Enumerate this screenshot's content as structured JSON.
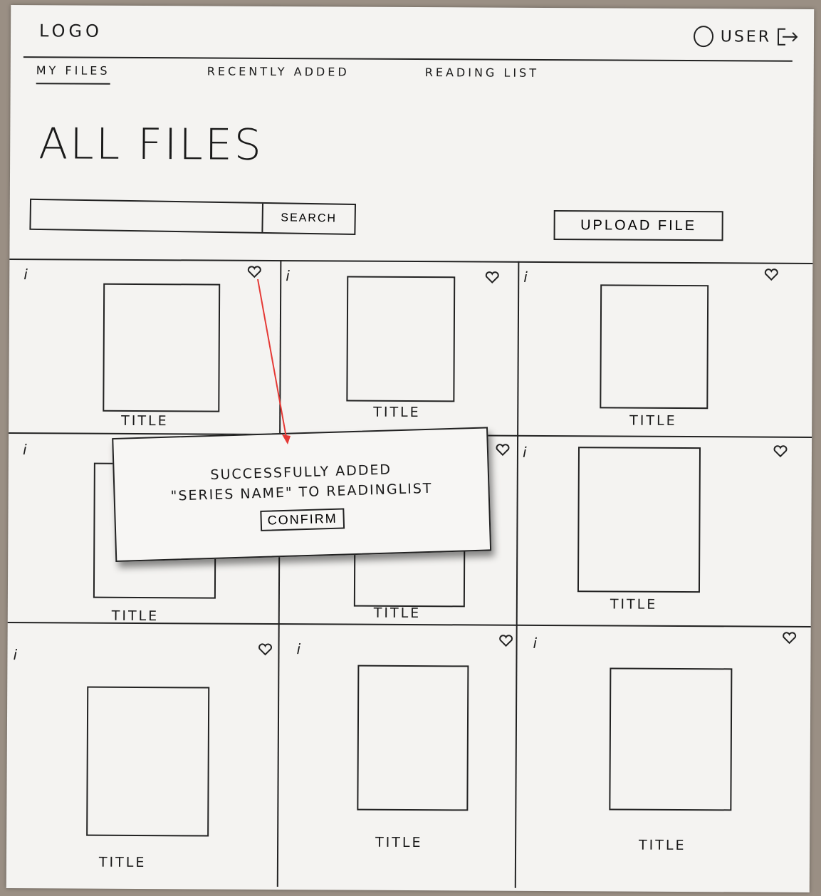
{
  "header": {
    "logo": "LOGO",
    "user_label": "USER"
  },
  "nav": {
    "items": [
      {
        "label": "MY FILES",
        "active": true
      },
      {
        "label": "RECENTLY ADDED",
        "active": false
      },
      {
        "label": "READING LIST",
        "active": false
      }
    ]
  },
  "page": {
    "title": "ALL FILES"
  },
  "search": {
    "placeholder": "",
    "button_label": "SEARCH"
  },
  "upload": {
    "label": "UPLOAD FILE"
  },
  "files": [
    {
      "title": "TITLE",
      "info": "i"
    },
    {
      "title": "TITLE",
      "info": "i"
    },
    {
      "title": "TITLE",
      "info": "i"
    },
    {
      "title": "TITLE",
      "info": "i"
    },
    {
      "title": "TITLE",
      "info": "i"
    },
    {
      "title": "TITLE",
      "info": "i"
    },
    {
      "title": "TITLE",
      "info": "i"
    },
    {
      "title": "TITLE",
      "info": "i"
    },
    {
      "title": "TITLE",
      "info": "i"
    }
  ],
  "modal": {
    "line1": "SUCCESSFULLY ADDED",
    "line2": "\"SERIES NAME\" TO READINGLIST",
    "confirm_label": "CONFIRM"
  },
  "annotation": {
    "arrow_color": "#e53935"
  }
}
